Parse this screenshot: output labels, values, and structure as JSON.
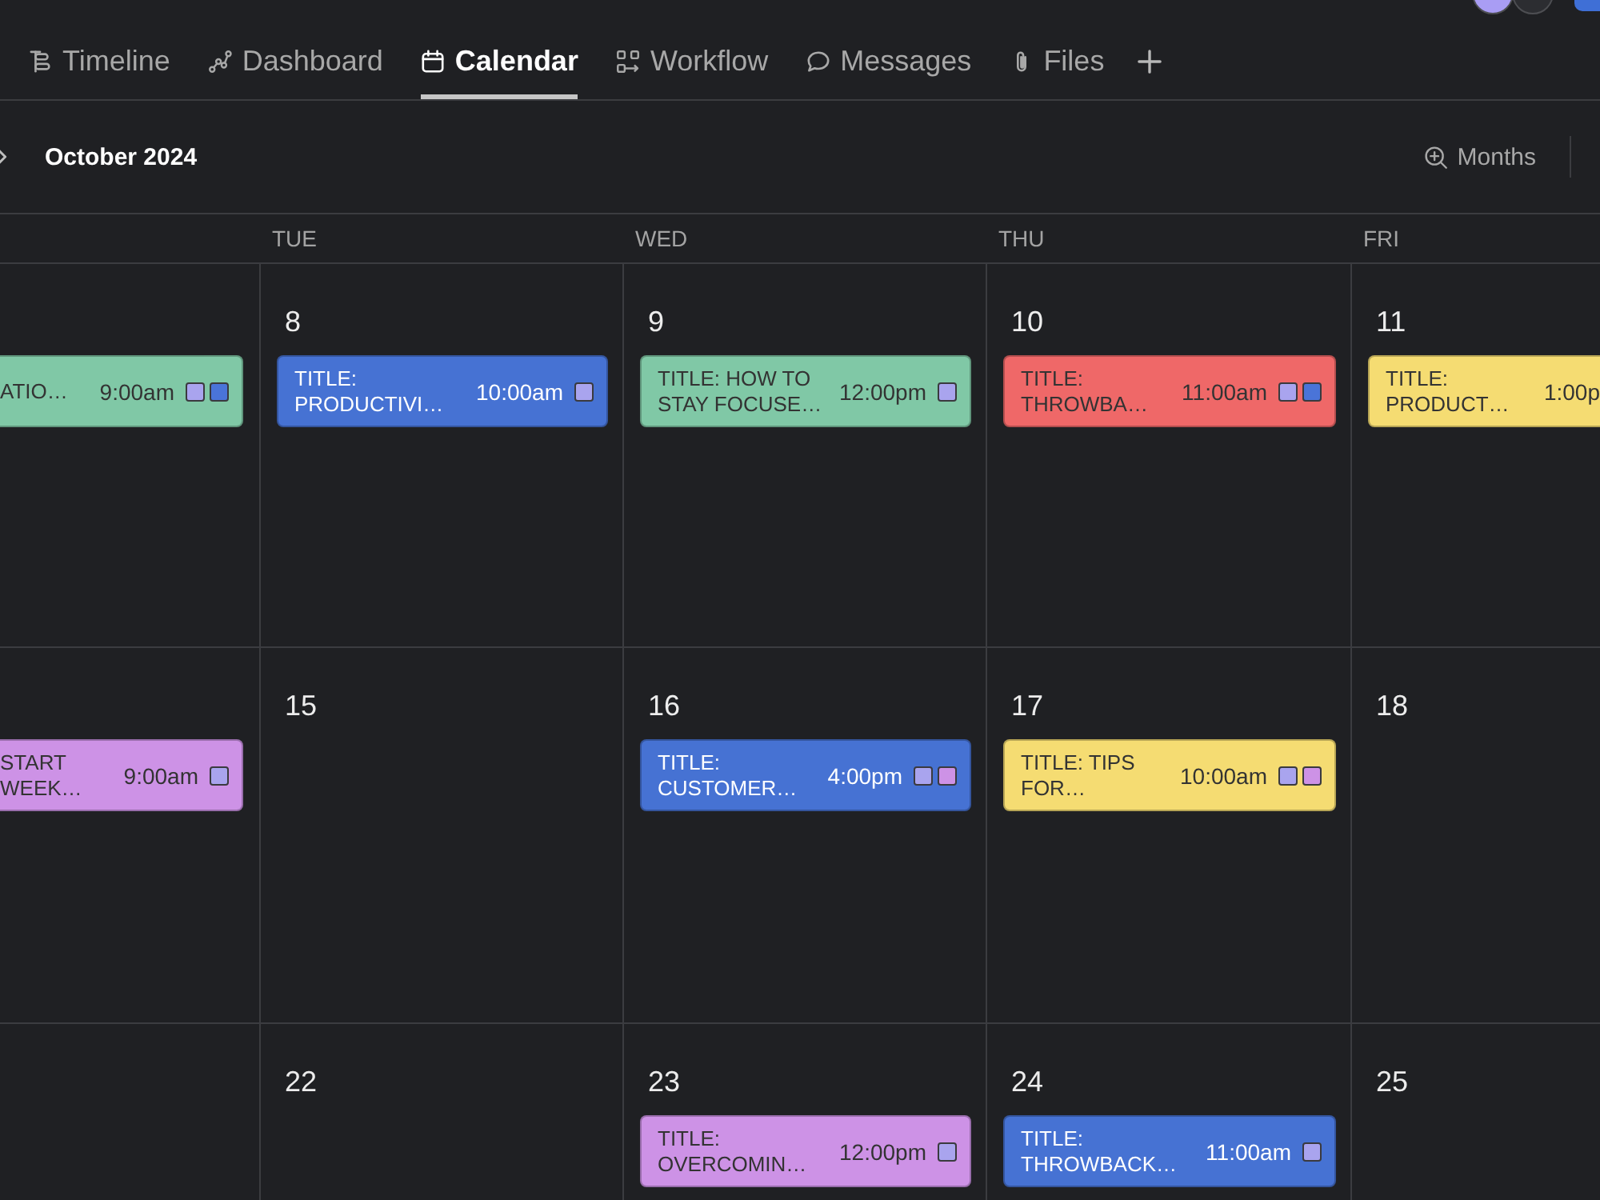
{
  "header": {
    "avatars": [
      {
        "color": "#a99df4"
      },
      {
        "color": "#2c2d31"
      }
    ]
  },
  "tabs": [
    {
      "label": "Timeline",
      "selected": false
    },
    {
      "label": "Dashboard",
      "selected": false
    },
    {
      "label": "Calendar",
      "selected": true
    },
    {
      "label": "Workflow",
      "selected": false
    },
    {
      "label": "Messages",
      "selected": false
    },
    {
      "label": "Files",
      "selected": false
    }
  ],
  "toolbar": {
    "title": "October 2024",
    "zoom_button": "Months"
  },
  "calendar": {
    "weekdays": [
      "TUE",
      "WED",
      "THU",
      "FRI"
    ],
    "weeks": [
      {
        "cut_day": {
          "events": [
            {
              "title": "ATIO…",
              "time": "9:00am",
              "color": "#80c8a6",
              "tags": [
                {
                  "color": "#a9a4ee"
                },
                {
                  "color": "#4a74d8"
                }
              ]
            }
          ]
        },
        "days": [
          {
            "date": "8",
            "events": [
              {
                "title": "TITLE: PRODUCTIVI…",
                "time": "10:00am",
                "color": "#4672d3",
                "tags": [
                  {
                    "color": "#a9a4ee"
                  }
                ]
              }
            ]
          },
          {
            "date": "9",
            "events": [
              {
                "title": "TITLE: HOW TO STAY FOCUSE…",
                "time": "12:00pm",
                "color": "#80c8a6",
                "tags": [
                  {
                    "color": "#a9a4ee"
                  }
                ]
              }
            ]
          },
          {
            "date": "10",
            "events": [
              {
                "title": "TITLE: THROWBA…",
                "time": "11:00am",
                "color": "#ef6868",
                "tags": [
                  {
                    "color": "#a9a4ee"
                  },
                  {
                    "color": "#4a74d8"
                  }
                ]
              }
            ]
          },
          {
            "date": "11",
            "events": [
              {
                "title": "TITLE: PRODUCT…",
                "time": "1:00p",
                "color": "#f5dc72"
              }
            ]
          }
        ]
      },
      {
        "cut_day": {
          "events": [
            {
              "title": "START WEEK…",
              "time": "9:00am",
              "color": "#cd92e6",
              "tags": [
                {
                  "color": "#a9a4ee"
                }
              ]
            }
          ]
        },
        "days": [
          {
            "date": "15"
          },
          {
            "date": "16",
            "events": [
              {
                "title": "TITLE: CUSTOMER…",
                "time": "4:00pm",
                "color": "#4672d3",
                "tags": [
                  {
                    "color": "#a9a4ee"
                  },
                  {
                    "color": "#cd92e6"
                  }
                ]
              }
            ]
          },
          {
            "date": "17",
            "events": [
              {
                "title": "TITLE: TIPS FOR…",
                "time": "10:00am",
                "color": "#f5dc72",
                "tags": [
                  {
                    "color": "#a9a4ee"
                  },
                  {
                    "color": "#cd92e6"
                  }
                ]
              }
            ]
          },
          {
            "date": "18"
          }
        ]
      },
      {
        "days": [
          {
            "date": "22"
          },
          {
            "date": "23",
            "events": [
              {
                "title": "TITLE: OVERCOMIN…",
                "time": "12:00pm",
                "color": "#cd92e6",
                "tags": [
                  {
                    "color": "#a9a4ee"
                  }
                ]
              }
            ]
          },
          {
            "date": "24",
            "events": [
              {
                "title": "TITLE: THROWBACK…",
                "time": "11:00am",
                "color": "#4672d3",
                "tags": [
                  {
                    "color": "#a9a4ee"
                  }
                ]
              }
            ]
          },
          {
            "date": "25"
          }
        ]
      }
    ]
  }
}
